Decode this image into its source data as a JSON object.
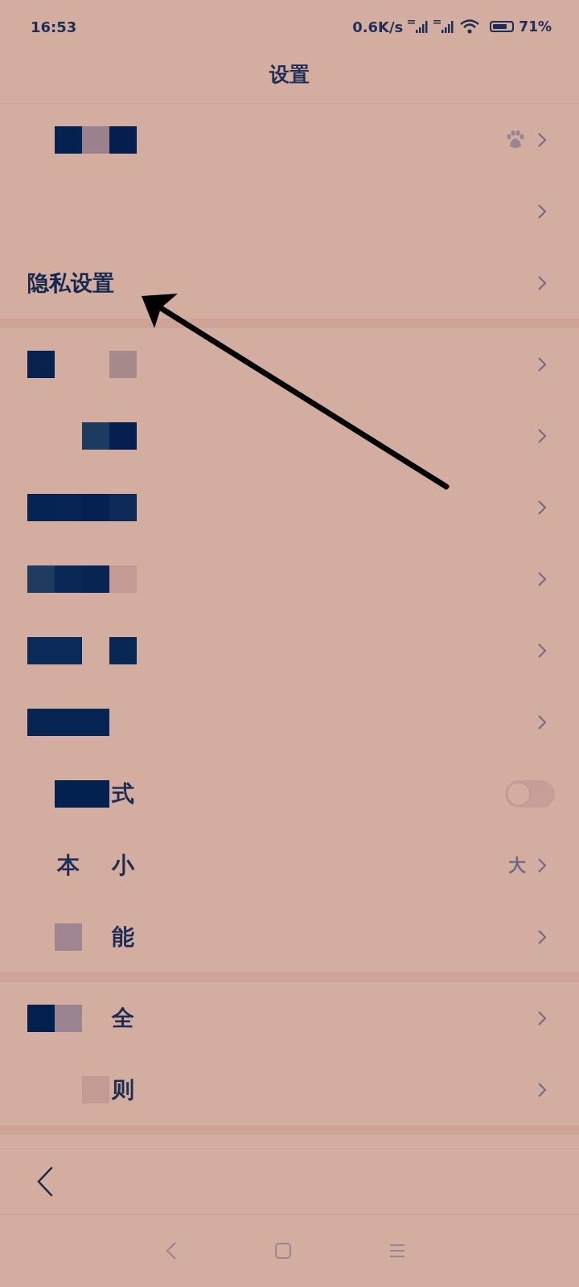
{
  "status_bar": {
    "time": "16:53",
    "speed": "0.6K/s",
    "battery": "71%"
  },
  "title": "设置",
  "sections": [
    {
      "rows": [
        {
          "cells": [
            {
              "kind": "blank"
            },
            {
              "kind": "block",
              "color": "#04224f"
            },
            {
              "kind": "block",
              "color": "#9a818c"
            },
            {
              "kind": "block",
              "color": "#041e4f"
            }
          ],
          "badge": true
        },
        {
          "cells": [
            {
              "kind": "blank"
            }
          ]
        },
        {
          "label": "隐私设置"
        }
      ]
    },
    {
      "rows": [
        {
          "cells": [
            {
              "kind": "block",
              "color": "#06234f"
            },
            {
              "kind": "blank"
            },
            {
              "kind": "blank"
            },
            {
              "kind": "block",
              "color": "#a68a8b"
            }
          ]
        },
        {
          "cells": [
            {
              "kind": "blank"
            },
            {
              "kind": "blank"
            },
            {
              "kind": "block",
              "color": "#1d3a5f"
            },
            {
              "kind": "block",
              "color": "#041f50"
            }
          ]
        },
        {
          "cells": [
            {
              "kind": "block",
              "color": "#052453"
            },
            {
              "kind": "block",
              "color": "#072553"
            },
            {
              "kind": "block",
              "color": "#042150"
            },
            {
              "kind": "block",
              "color": "#0d2b56"
            }
          ]
        },
        {
          "cells": [
            {
              "kind": "block",
              "color": "#1e3b60"
            },
            {
              "kind": "block",
              "color": "#0a2855"
            },
            {
              "kind": "block",
              "color": "#072452"
            },
            {
              "kind": "block",
              "color": "#c39a94"
            }
          ]
        },
        {
          "cells": [
            {
              "kind": "block",
              "color": "#0a2a57"
            },
            {
              "kind": "block",
              "color": "#0a2a57"
            },
            {
              "kind": "blank"
            },
            {
              "kind": "block",
              "color": "#072853"
            }
          ]
        },
        {
          "cells": [
            {
              "kind": "block",
              "color": "#062553"
            },
            {
              "kind": "block",
              "color": "#062553"
            },
            {
              "kind": "block",
              "color": "#062553"
            }
          ]
        },
        {
          "cells": [
            {
              "kind": "blank"
            },
            {
              "kind": "block",
              "color": "#03214f"
            },
            {
              "kind": "block",
              "color": "#03214f"
            },
            {
              "kind": "char",
              "text": "式"
            }
          ],
          "toggle": {
            "on": false
          }
        },
        {
          "cells": [
            {
              "kind": "blank"
            },
            {
              "kind": "char",
              "text": "本"
            },
            {
              "kind": "blank"
            },
            {
              "kind": "char",
              "text": "小"
            }
          ],
          "value": "大"
        },
        {
          "cells": [
            {
              "kind": "blank"
            },
            {
              "kind": "block",
              "color": "#9f8690"
            },
            {
              "kind": "blank"
            },
            {
              "kind": "char",
              "text": "能"
            }
          ]
        }
      ]
    },
    {
      "rows": [
        {
          "cells": [
            {
              "kind": "block",
              "color": "#03214f"
            },
            {
              "kind": "block",
              "color": "#9a8590"
            },
            {
              "kind": "blank"
            },
            {
              "kind": "char",
              "text": "全"
            }
          ]
        },
        {
          "cells": [
            {
              "kind": "blank"
            },
            {
              "kind": "blank"
            },
            {
              "kind": "block",
              "color": "#c39a94"
            },
            {
              "kind": "char",
              "text": "则"
            }
          ]
        }
      ]
    }
  ]
}
